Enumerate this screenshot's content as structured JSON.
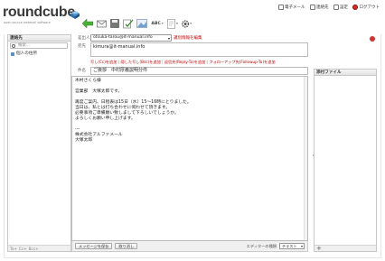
{
  "app": {
    "logo_text": "roundcube",
    "tagline": "open source webmail software"
  },
  "topnav": [
    {
      "label": "電子メール",
      "icon": "mail-icon"
    },
    {
      "label": "連絡先",
      "icon": "address-book-icon"
    },
    {
      "label": "設定",
      "icon": "settings-icon"
    },
    {
      "label": "ログアウト",
      "icon": "logout-icon"
    }
  ],
  "toolbar": {
    "back_icon": "back-arrow-icon",
    "send_icon": "send-icon",
    "attach_icon": "paperclip-icon",
    "spell_icon": "spellcheck-icon",
    "image_icon": "image-icon",
    "abc_label": "ABC",
    "signature_icon": "signature-icon",
    "options_icon": "gear-icon"
  },
  "contacts": {
    "title": "連絡先",
    "search_placeholder": "検索...",
    "address_book": "個人の住所",
    "footer": [
      "To+",
      "Cc+",
      "Bcc+"
    ]
  },
  "compose": {
    "from_label": "差出人",
    "from_value": "otsuka-tarou@it-manual.info",
    "from_edit_link": "識別情報を編集",
    "to_label": "宛先",
    "to_value": "kimura@it-manual.info",
    "add_links": [
      "写し(Cc)を追加",
      "隠した写し(Bcc)を追加",
      "返信先(Reply-To)を追加",
      "フォローアップ先(Followup-To)を追加"
    ],
    "subject_label": "件名",
    "subject_value": "ご挨拶　中村厚義説明分件",
    "body_lines": [
      "木村さくら様",
      "",
      "営業部　大塚太郎です。",
      "",
      "再度ご案内、日程表は15日（水）15〜16時にとりました。",
      "当日は、私とは打ち合わせに伺わせて頂きます。",
      "必要事項ご準備願い致しまして下ろしいでしょうか。",
      "よろしくお願い申し上げます。",
      "",
      "---",
      "株式会社アルファメール",
      "大塚太郎"
    ],
    "save_button": "メッセージを保存",
    "cancel_button": "取り消し",
    "editor_type_label": "エディターの種類",
    "editor_type_value": "テキスト"
  },
  "attachments": {
    "title": "添付ファイル",
    "add_button": "+"
  },
  "colors": {
    "link_red": "#bb0000",
    "border": "#c7c7c7",
    "accent_blue": "#5b8fc7"
  }
}
